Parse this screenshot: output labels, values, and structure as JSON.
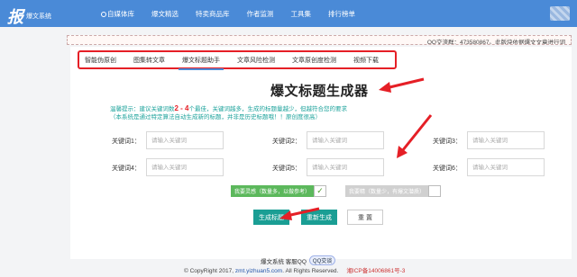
{
  "brand": {
    "logo_text": "报",
    "sub": "爆文系统"
  },
  "nav": [
    {
      "label": "自媒体库",
      "icon": "media-icon"
    },
    {
      "label": "爆文精选",
      "icon": ""
    },
    {
      "label": "特卖商品库",
      "icon": ""
    },
    {
      "label": "作者监测",
      "icon": ""
    },
    {
      "label": "工具集",
      "icon": ""
    },
    {
      "label": "排行榜单",
      "icon": ""
    }
  ],
  "notice": "QQ交流群：473580867。此版块依据爆文文章进行词",
  "tabs": [
    {
      "label": "智能伪原创"
    },
    {
      "label": "图集转文章"
    },
    {
      "label": "爆文标题助手",
      "active": true
    },
    {
      "label": "文章风险检测"
    },
    {
      "label": "文章原创度检测"
    },
    {
      "label": "视频下载"
    }
  ],
  "title": "爆文标题生成器",
  "tip": {
    "line1_pre": "温馨提示：建议关键词数",
    "line1_range": "2 - 4",
    "line1_post": "个最佳，关键词越多，生成的标题量越少，但越符合您的要求",
    "line2": "（本系统是通过特定算法自动生成新的标题，并非是历史标题哦！！原创度很高）"
  },
  "keywords": [
    {
      "label": "关键词1：",
      "placeholder": "请输入关键词"
    },
    {
      "label": "关键词2：",
      "placeholder": "请输入关键词"
    },
    {
      "label": "关键词3：",
      "placeholder": "请输入关键词"
    },
    {
      "label": "关键词4：",
      "placeholder": "请输入关键词"
    },
    {
      "label": "关键词5：",
      "placeholder": "请输入关键词"
    },
    {
      "label": "关键词6：",
      "placeholder": "请输入关键词"
    }
  ],
  "options": {
    "inspire": {
      "label": "我要灵感（数量多，以做参考）",
      "checked": true,
      "mark": "✓",
      "color": "#5cb85c"
    },
    "precise": {
      "label": "我要精（数量少，有爆文潜质）",
      "checked": false,
      "mark": "",
      "color": "#d0d0d0"
    }
  },
  "buttons": {
    "generate": "生成标题",
    "regenerate": "重新生成",
    "reset": "重 置"
  },
  "footer": {
    "line1_text": "爆文系统 客服QQ",
    "qq_badge": "QQ交谈",
    "copyright": "© CopyRight 2017, ",
    "domain": "zmt.yizhuan5.com",
    "rights": ". All Rights Reserved.",
    "icp": "湘ICP备14006861号-3"
  },
  "colors": {
    "nav_bg": "#4a8ad7",
    "annotation_red": "#e51f26",
    "teal": "#1a9e94"
  }
}
